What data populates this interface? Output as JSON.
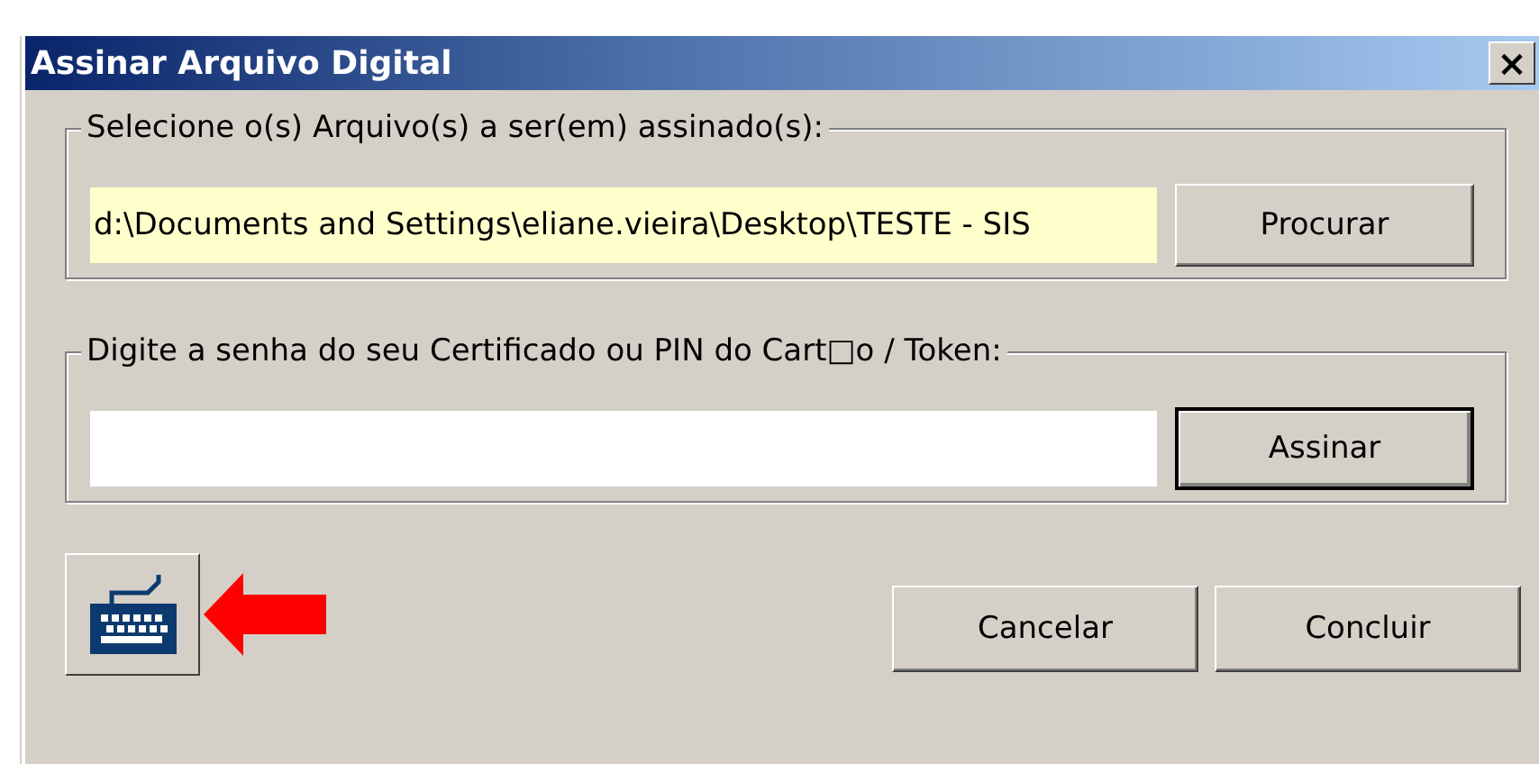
{
  "window": {
    "title": "Assinar Arquivo Digital",
    "close": "×"
  },
  "file_group": {
    "legend": "Selecione o(s) Arquivo(s) a ser(em) assinado(s):",
    "value": "d:\\Documents and Settings\\eliane.vieira\\Desktop\\TESTE - SIS",
    "button": "Procurar"
  },
  "password_group": {
    "legend": "Digite a senha do seu Certificado ou PIN do Cart□o / Token:",
    "button": "Assinar"
  },
  "buttons": [
    "Cancelar",
    "Concluir"
  ]
}
